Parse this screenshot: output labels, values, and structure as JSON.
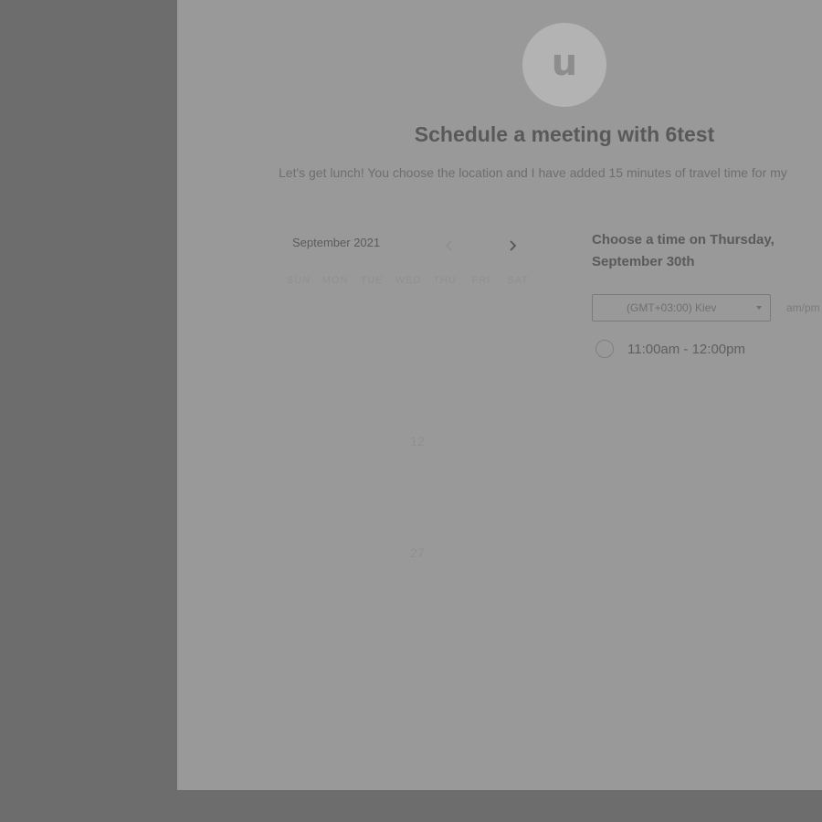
{
  "meeting": {
    "avatar_letter": "u",
    "title": "Schedule a meeting with 6test",
    "description": "Let's get lunch! You choose the location and I have added 15 minutes of travel time for my"
  },
  "calendar": {
    "month_label": "September 2021",
    "weekdays": [
      "SUN",
      "MON",
      "TUE",
      "WED",
      "THU",
      "FRI",
      "SAT"
    ],
    "visible_days": [
      "12",
      "27"
    ]
  },
  "time_picker": {
    "heading": "Choose a time on Thursday, September 30th",
    "timezone_value": "(GMT+03:00) Kiev",
    "format_label": "am/pm",
    "slots": [
      {
        "label": "11:00am - 12:00pm"
      }
    ]
  },
  "icons": {
    "prev": "chevron-left-icon",
    "next": "chevron-right-icon",
    "dropdown": "caret-down-icon"
  },
  "colors": {
    "backdrop": "#6d6d6d",
    "card": "#999999",
    "avatar": "#b3b3b3"
  }
}
